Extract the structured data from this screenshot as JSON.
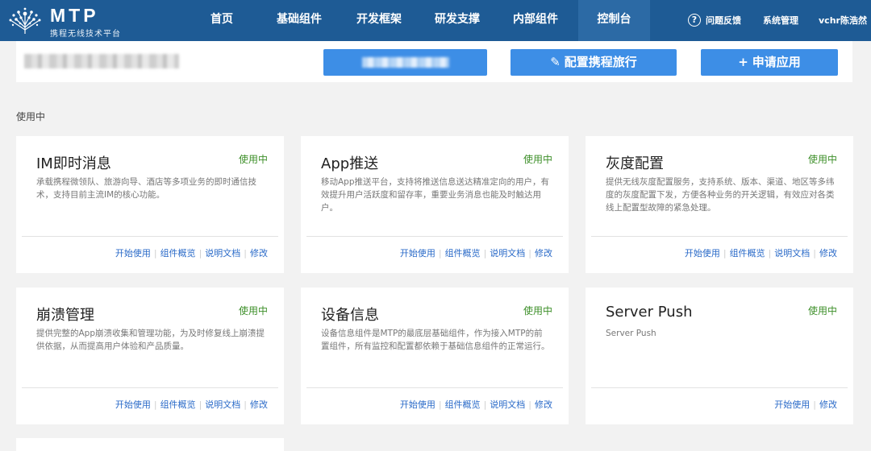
{
  "brand": {
    "title": "MTP",
    "subtitle": "携程无线技术平台"
  },
  "nav": {
    "items": [
      {
        "label": "首页"
      },
      {
        "label": "基础组件"
      },
      {
        "label": "开发框架"
      },
      {
        "label": "研发支撑"
      },
      {
        "label": "内部组件"
      },
      {
        "label": "控制台",
        "active": true
      }
    ],
    "help_icon": "?",
    "feedback": "问题反馈",
    "admin": "系统管理",
    "user": "vchr陈浩然"
  },
  "header": {
    "config_button": "配置携程旅行",
    "config_icon": "edit-icon",
    "apply_button": "申请应用",
    "apply_icon": "plus-icon"
  },
  "section": {
    "label": "使用中"
  },
  "cards": [
    {
      "title": "IM即时消息",
      "status": "使用中",
      "description": "承载携程微领队、旅游向导、酒店等多项业务的即时通信技术，支持目前主流IM的核心功能。",
      "actions": [
        "开始使用",
        "组件概览",
        "说明文档",
        "修改"
      ]
    },
    {
      "title": "App推送",
      "status": "使用中",
      "description": "移动App推送平台，支持将推送信息送达精准定向的用户，有效提升用户活跃度和留存率，重要业务消息也能及时触达用户。",
      "actions": [
        "开始使用",
        "组件概览",
        "说明文档",
        "修改"
      ]
    },
    {
      "title": "灰度配置",
      "status": "使用中",
      "description": "提供无线灰度配置服务，支持系统、版本、渠道、地区等多纬度的灰度配置下发，方便各种业务的开关逻辑，有效应对各类线上配置型故障的紧急处理。",
      "actions": [
        "开始使用",
        "组件概览",
        "说明文档",
        "修改"
      ]
    },
    {
      "title": "崩溃管理",
      "status": "使用中",
      "description": "提供完整的App崩溃收集和管理功能，为及时修复线上崩溃提供依据，从而提高用户体验和产品质量。",
      "actions": [
        "开始使用",
        "组件概览",
        "说明文档",
        "修改"
      ]
    },
    {
      "title": "设备信息",
      "status": "使用中",
      "description": "设备信息组件是MTP的最底层基础组件，作为接入MTP的前置组件，所有监控和配置都依赖于基础信息组件的正常运行。",
      "actions": [
        "开始使用",
        "组件概览",
        "说明文档",
        "修改"
      ]
    },
    {
      "title": "Server Push",
      "status": "使用中",
      "description": "Server Push",
      "actions": [
        "开始使用",
        "修改"
      ]
    }
  ],
  "colors": {
    "nav_bg": "#1e5b95",
    "nav_active": "#2c6aa5",
    "button": "#3d8ee6",
    "status_green": "#3d8f29",
    "link_blue": "#2a6ac8"
  }
}
